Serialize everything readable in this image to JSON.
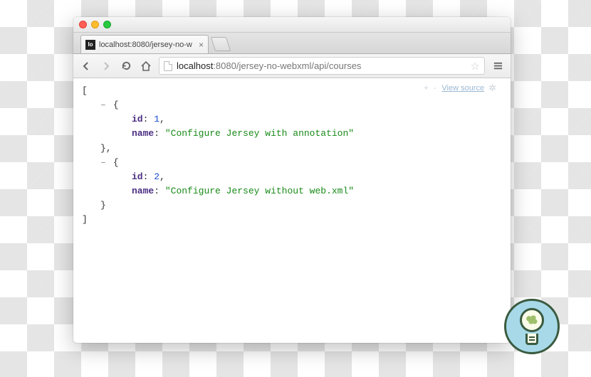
{
  "tab": {
    "title": "localhost:8080/jersey-no-w",
    "favicon_text": "lo"
  },
  "url": {
    "host_strong": "localhost",
    "host_rest": ":8080",
    "path": "/jersey-no-webxml/api/courses"
  },
  "viewer": {
    "plusminus": "+ -",
    "view_source_label": "View source"
  },
  "json_body": [
    {
      "id": 1,
      "name": "Configure Jersey with annotation"
    },
    {
      "id": 2,
      "name": "Configure Jersey without web.xml"
    }
  ],
  "keys": {
    "id": "id",
    "name": "name"
  }
}
